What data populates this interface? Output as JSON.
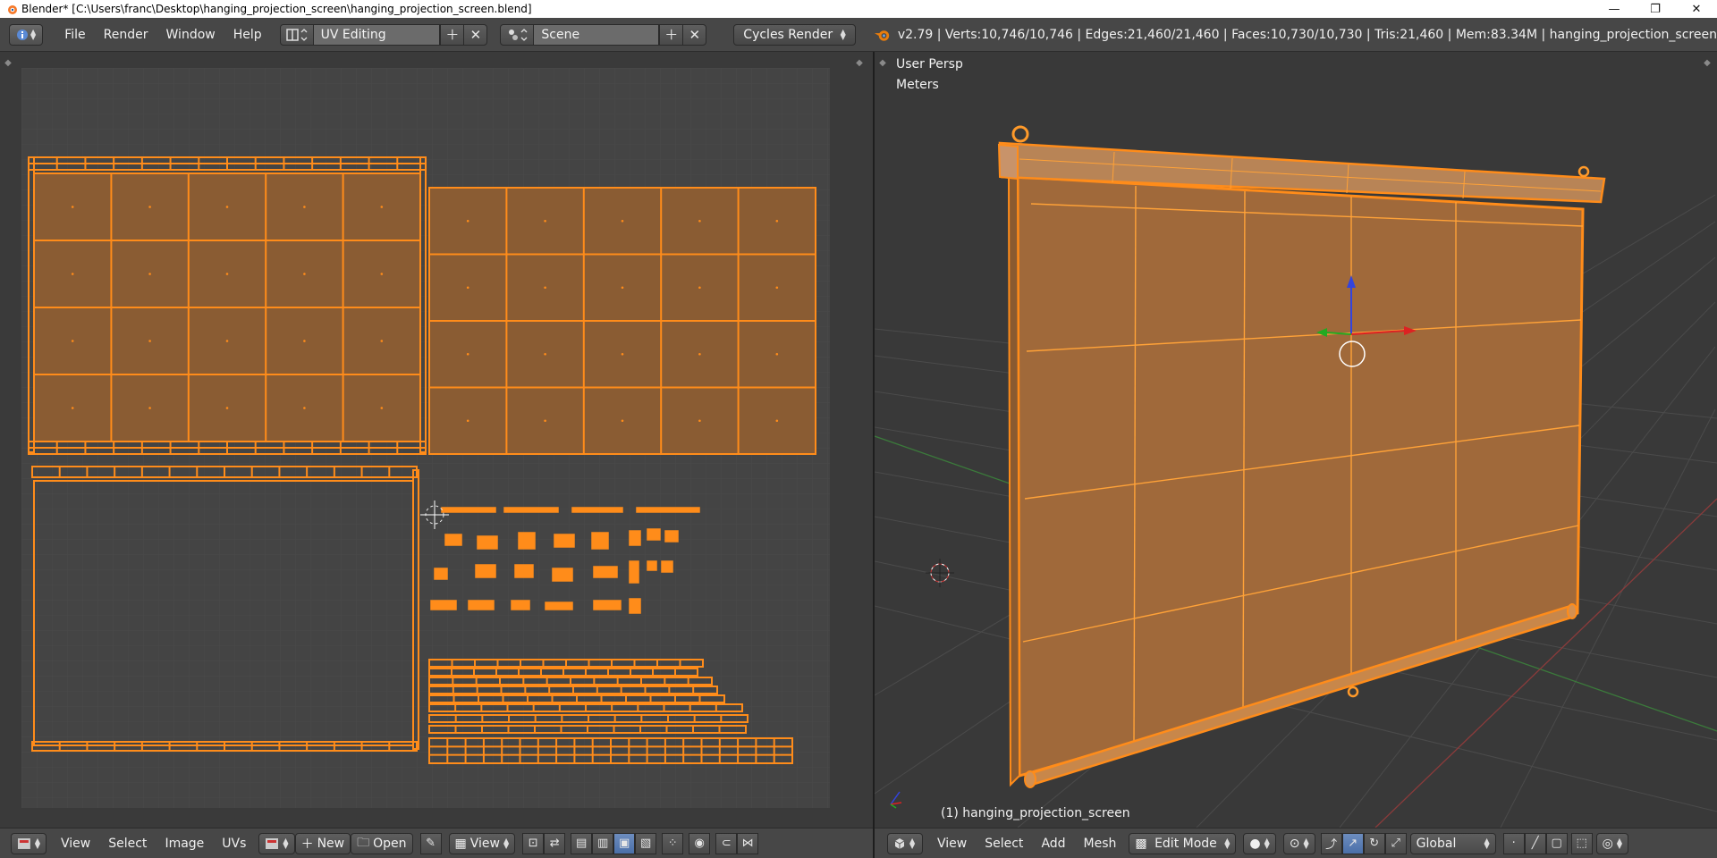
{
  "titlebar": {
    "title": "Blender* [C:\\Users\\franc\\Desktop\\hanging_projection_screen\\hanging_projection_screen.blend]",
    "minimize": "—",
    "restore": "❐",
    "close": "✕"
  },
  "infobar": {
    "menus": [
      "File",
      "Render",
      "Window",
      "Help"
    ],
    "screen_layout": "UV Editing",
    "scene": "Scene",
    "render_engine": "Cycles Render",
    "stats": "v2.79 | Verts:10,746/10,746 | Edges:21,460/21,460 | Faces:10,730/10,730 | Tris:21,460 | Mem:83.34M | hanging_projection_screen"
  },
  "uv_editor": {
    "menus": [
      "View",
      "Select",
      "Image",
      "UVs"
    ],
    "new_label": "New",
    "open_label": "Open",
    "view_label": "View"
  },
  "viewport": {
    "view_name": "User Persp",
    "units": "Meters",
    "object_label": "(1) hanging_projection_screen",
    "menus": [
      "View",
      "Select",
      "Add",
      "Mesh"
    ],
    "mode": "Edit Mode",
    "orientation": "Global"
  },
  "colors": {
    "selection_orange": "#ff8c1a",
    "face_fill": "#8a5c33",
    "background": "#3d3d3d",
    "header": "#474747"
  }
}
